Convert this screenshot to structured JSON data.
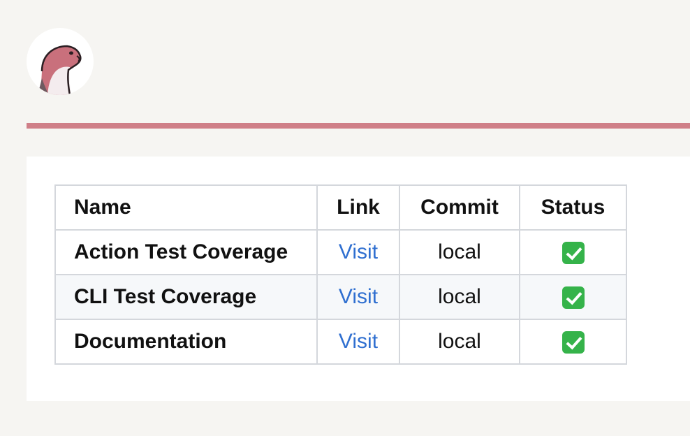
{
  "colors": {
    "page_background": "#f6f5f2",
    "divider": "#cf7f88",
    "link": "#2f6fd0",
    "status_ok": "#35b34a"
  },
  "logo": {
    "icon": "otter-mascot-icon"
  },
  "table": {
    "headers": {
      "name": "Name",
      "link": "Link",
      "commit": "Commit",
      "status": "Status"
    },
    "rows": [
      {
        "name": "Action Test Coverage",
        "link": "Visit",
        "commit": "local",
        "status": "check-mark-icon"
      },
      {
        "name": "CLI Test Coverage",
        "link": "Visit",
        "commit": "local",
        "status": "check-mark-icon"
      },
      {
        "name": "Documentation",
        "link": "Visit",
        "commit": "local",
        "status": "check-mark-icon"
      }
    ]
  }
}
